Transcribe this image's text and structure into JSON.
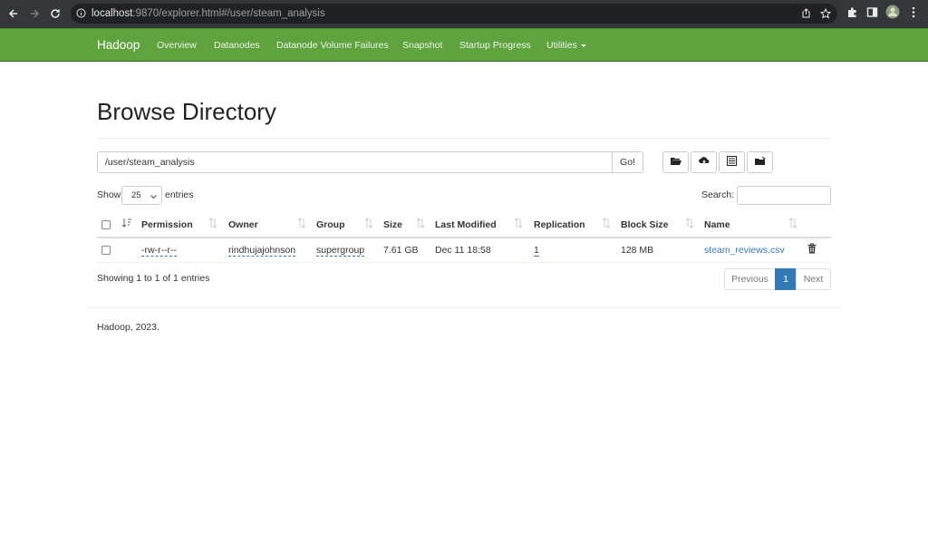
{
  "browser": {
    "url_host": "localhost",
    "url_rest": ":9870/explorer.html#/user/steam_analysis"
  },
  "navbar": {
    "brand": "Hadoop",
    "items": [
      "Overview",
      "Datanodes",
      "Datanode Volume Failures",
      "Snapshot",
      "Startup Progress",
      "Utilities"
    ]
  },
  "page": {
    "title": "Browse Directory",
    "path": "/user/steam_analysis",
    "go_label": "Go!"
  },
  "table_controls": {
    "show_label": "Show",
    "page_length": "25",
    "entries_label": "entries",
    "search_label": "Search:"
  },
  "table": {
    "headers": [
      "Permission",
      "Owner",
      "Group",
      "Size",
      "Last Modified",
      "Replication",
      "Block Size",
      "Name"
    ],
    "rows": [
      {
        "permission": "-rw-r--r--",
        "owner": "rindhujajohnson",
        "group": "supergroup",
        "size": "7.61 GB",
        "last_modified": "Dec 11 18:58",
        "replication": "1",
        "block_size": "128 MB",
        "name": "steam_reviews.csv"
      }
    ]
  },
  "pagination": {
    "info": "Showing 1 to 1 of 1 entries",
    "previous": "Previous",
    "current": "1",
    "next": "Next"
  },
  "footer": {
    "text": "Hadoop, 2023."
  },
  "colors": {
    "navbar": "#5fa33e",
    "link": "#337ab7",
    "active_page": "#337ab7"
  }
}
